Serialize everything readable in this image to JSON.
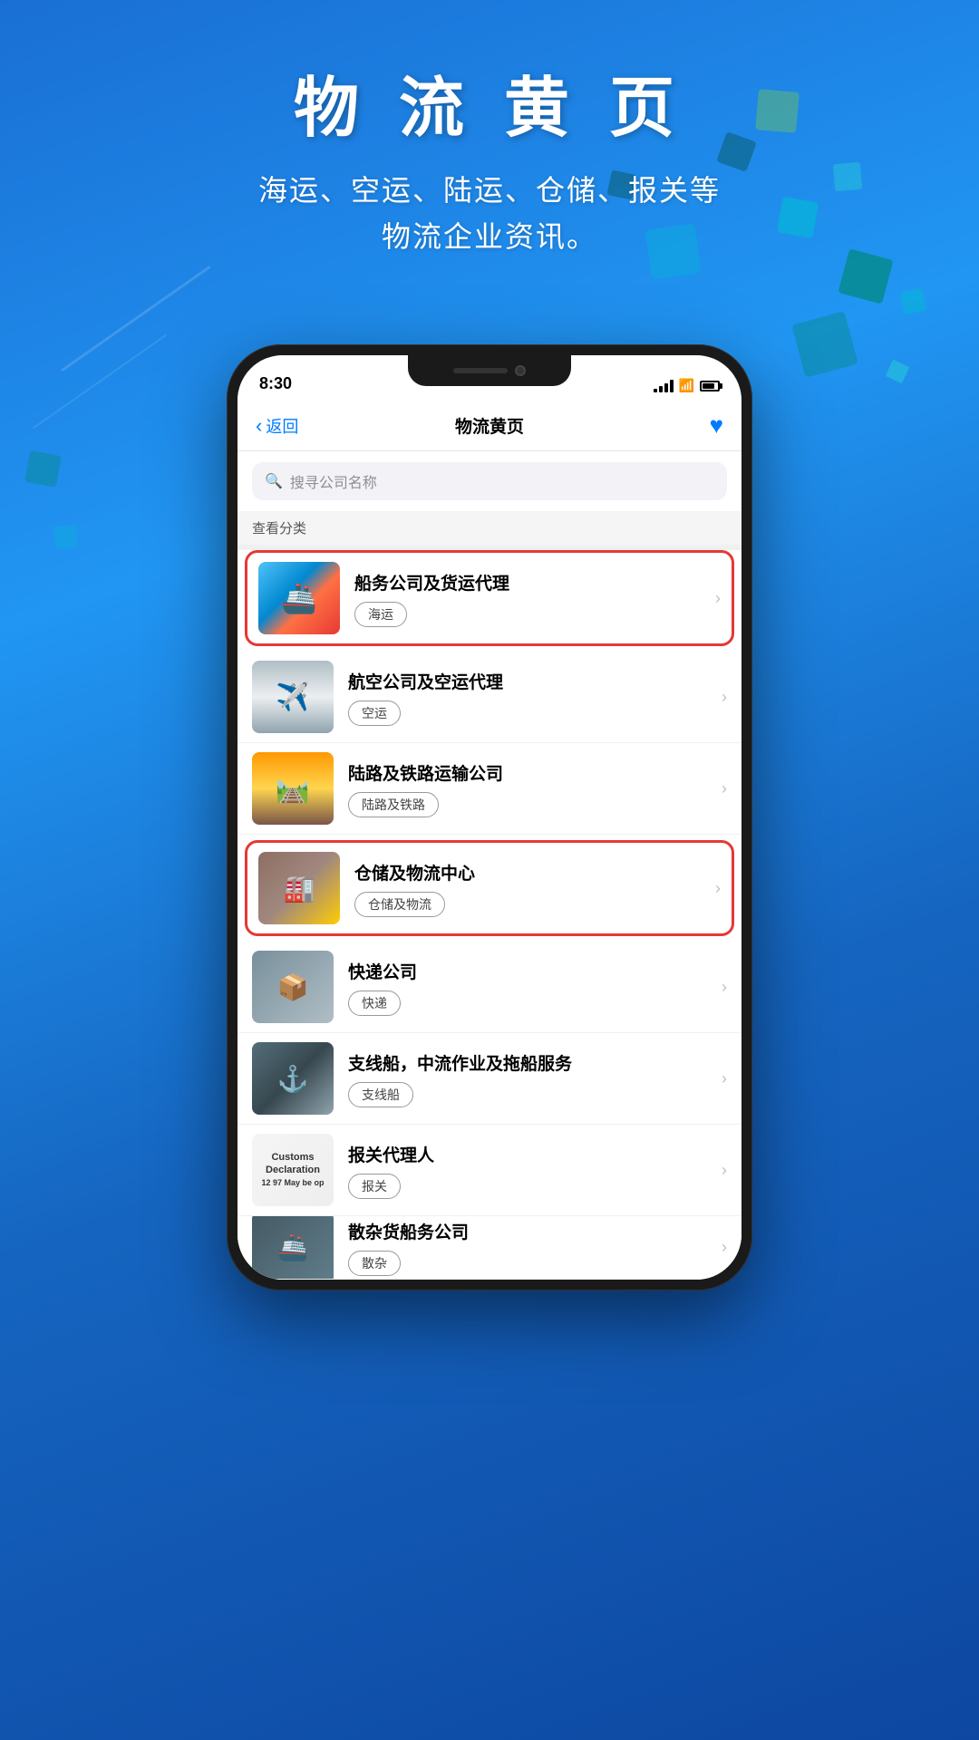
{
  "background": {
    "gradient_start": "#1a6fd4",
    "gradient_end": "#0d47a1"
  },
  "header": {
    "main_title": "物 流 黄 页",
    "sub_title_line1": "海运、空运、陆运、仓储、报关等",
    "sub_title_line2": "物流企业资讯。"
  },
  "phone": {
    "status_bar": {
      "time": "8:30"
    },
    "nav_bar": {
      "back_label": "返回",
      "title": "物流黄页"
    },
    "search": {
      "placeholder": "搜寻公司名称"
    },
    "category_label": "查看分类",
    "list_items": [
      {
        "id": "shipping",
        "title": "船务公司及货运代理",
        "tag": "海运",
        "highlighted": true,
        "img_type": "ship"
      },
      {
        "id": "airline",
        "title": "航空公司及空运代理",
        "tag": "空运",
        "highlighted": false,
        "img_type": "plane"
      },
      {
        "id": "land",
        "title": "陆路及铁路运输公司",
        "tag": "陆路及铁路",
        "highlighted": false,
        "img_type": "rail"
      },
      {
        "id": "warehouse",
        "title": "仓储及物流中心",
        "tag": "仓储及物流",
        "highlighted": true,
        "img_type": "warehouse"
      },
      {
        "id": "courier",
        "title": "快递公司",
        "tag": "快递",
        "highlighted": false,
        "img_type": "courier"
      },
      {
        "id": "feeder",
        "title": "支线船，中流作业及拖船服务",
        "tag": "支线船",
        "highlighted": false,
        "img_type": "feeder"
      },
      {
        "id": "customs",
        "title": "报关代理人",
        "tag": "报关",
        "highlighted": false,
        "img_type": "customs",
        "customs_text": "12 97 May be op"
      },
      {
        "id": "bulk",
        "title": "散杂货船务公司",
        "tag": "散杂",
        "highlighted": false,
        "img_type": "bulk",
        "partial": true
      }
    ]
  }
}
